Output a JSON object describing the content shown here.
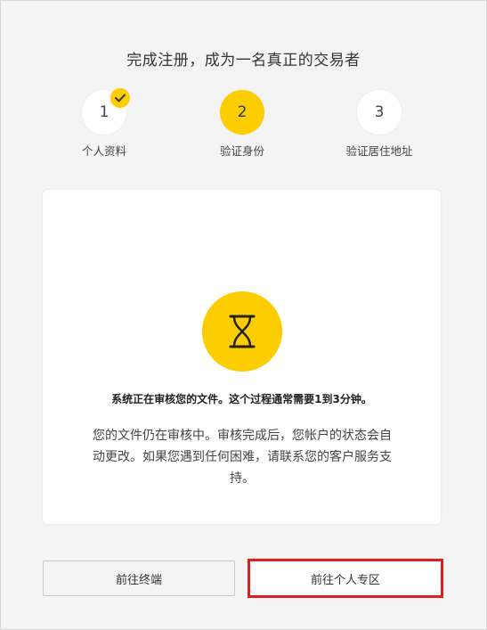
{
  "header": {
    "title": "完成注册，成为一名真正的交易者"
  },
  "steps": [
    {
      "number": "1",
      "label": "个人资料",
      "status": "completed",
      "icon": "check-icon"
    },
    {
      "number": "2",
      "label": "验证身份",
      "status": "active"
    },
    {
      "number": "3",
      "label": "验证居住地址",
      "status": "pending"
    }
  ],
  "card": {
    "icon": "hourglass-icon",
    "status_title": "系统正在审核您的文件。这个过程通常需要1到3分钟。",
    "status_description": "您的文件仍在审核中。审核完成后，您帐户的状态会自动更改。如果您遇到任何困难，请联系您的客户服务支持。"
  },
  "buttons": {
    "terminal_label": "前往终端",
    "profile_label": "前往个人专区"
  },
  "colors": {
    "accent": "#fccd00",
    "highlight_border": "#e02020",
    "background": "#f4f4f4"
  }
}
